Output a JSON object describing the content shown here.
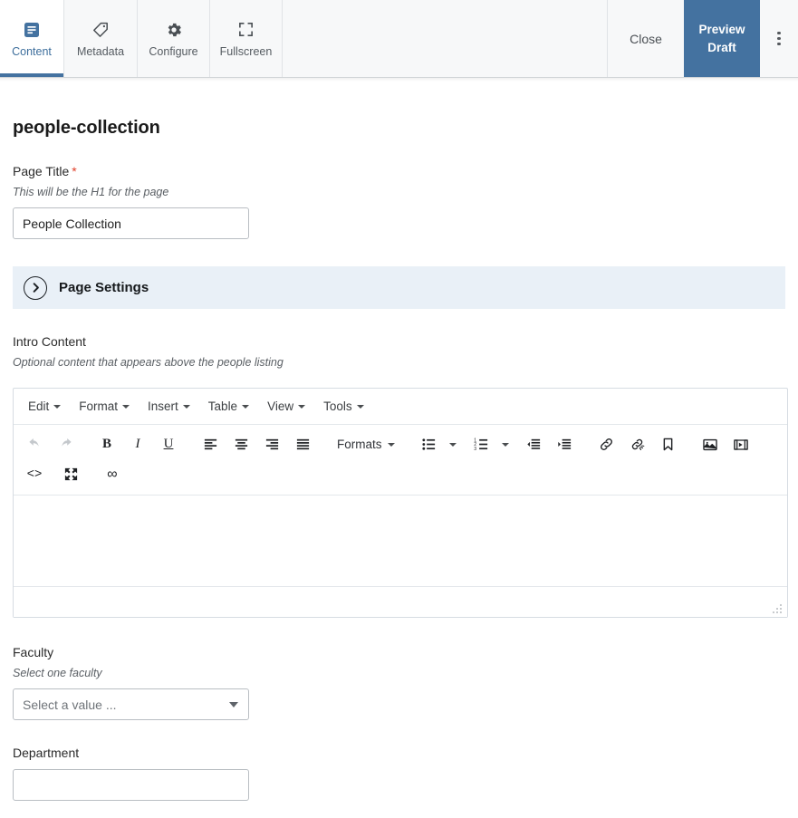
{
  "topbar": {
    "tabs": [
      {
        "label": "Content",
        "icon": "document-lines-icon",
        "active": true
      },
      {
        "label": "Metadata",
        "icon": "tag-icon",
        "active": false
      },
      {
        "label": "Configure",
        "icon": "gear-icon",
        "active": false
      },
      {
        "label": "Fullscreen",
        "icon": "expand-icon",
        "active": false
      }
    ],
    "close_label": "Close",
    "preview_label_line1": "Preview",
    "preview_label_line2": "Draft",
    "kebab_icon": "kebab-menu-icon",
    "accent_color": "#4472a0",
    "active_tab_text_color": "#3d6e9c"
  },
  "page": {
    "heading": "people-collection"
  },
  "page_title_field": {
    "label": "Page Title",
    "required_marker": "*",
    "hint": "This will be the H1 for the page",
    "value": "People Collection",
    "placeholder": ""
  },
  "page_settings": {
    "title": "Page Settings",
    "icon": "chevron-right-circle-icon",
    "background_color": "#e9f0f7",
    "expanded": false
  },
  "intro_content": {
    "label": "Intro Content",
    "hint": "Optional content that appears above the people listing",
    "editor": {
      "menubar": [
        {
          "label": "Edit"
        },
        {
          "label": "Format"
        },
        {
          "label": "Insert"
        },
        {
          "label": "Table"
        },
        {
          "label": "View"
        },
        {
          "label": "Tools"
        }
      ],
      "toolbar_row1": [
        {
          "name": "undo-icon",
          "label": "Undo",
          "disabled": true
        },
        {
          "name": "redo-icon",
          "label": "Redo",
          "disabled": true
        },
        {
          "name": "bold-icon",
          "label": "Bold",
          "glyph": "B"
        },
        {
          "name": "italic-icon",
          "label": "Italic",
          "glyph": "I"
        },
        {
          "name": "underline-icon",
          "label": "Underline",
          "glyph": "U"
        },
        {
          "name": "align-left-icon",
          "label": "Align left"
        },
        {
          "name": "align-center-icon",
          "label": "Align center"
        },
        {
          "name": "align-right-icon",
          "label": "Align right"
        },
        {
          "name": "align-justify-icon",
          "label": "Justify"
        },
        {
          "name": "formats-dropdown",
          "label": "Formats"
        },
        {
          "name": "bullet-list-icon",
          "label": "Bullet list"
        },
        {
          "name": "numbered-list-icon",
          "label": "Numbered list"
        },
        {
          "name": "outdent-icon",
          "label": "Decrease indent"
        },
        {
          "name": "indent-icon",
          "label": "Increase indent"
        },
        {
          "name": "link-icon",
          "label": "Insert/edit link"
        },
        {
          "name": "unlink-icon",
          "label": "Remove link"
        },
        {
          "name": "anchor-icon",
          "label": "Anchor"
        },
        {
          "name": "image-icon",
          "label": "Insert/edit image"
        },
        {
          "name": "media-icon",
          "label": "Insert/edit media"
        }
      ],
      "toolbar_row2": [
        {
          "name": "source-code-icon",
          "label": "Source code",
          "glyph": "<>"
        },
        {
          "name": "fullscreen-icon",
          "label": "Fullscreen"
        },
        {
          "name": "infinity-icon",
          "label": "Equation",
          "glyph": "∞"
        }
      ],
      "formats_label": "Formats",
      "body_text": ""
    }
  },
  "faculty_field": {
    "label": "Faculty",
    "hint": "Select one faculty",
    "selected_value": "Select a value ...",
    "icon": "chevron-down-icon"
  },
  "department_field": {
    "label": "Department",
    "value": "",
    "placeholder": ""
  }
}
